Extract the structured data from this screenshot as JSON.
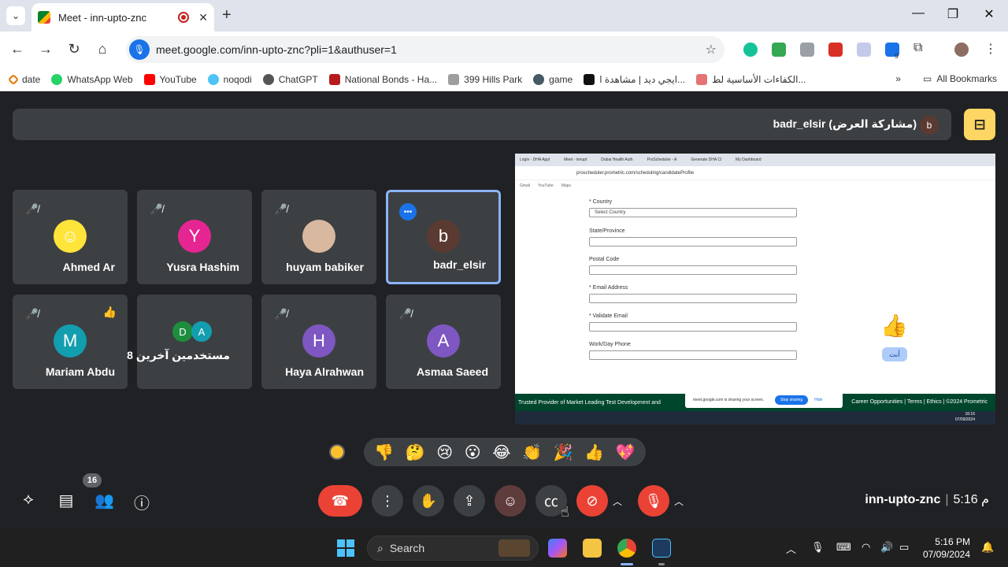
{
  "browser": {
    "tab_title": "Meet - inn-upto-znc",
    "url": "meet.google.com/inn-upto-znc?pli=1&authuser=1",
    "bookmarks": [
      "date",
      "WhatsApp Web",
      "YouTube",
      "noqodi",
      "ChatGPT",
      "National Bonds - Ha...",
      "399 Hills Park",
      "game",
      "ايجي ديد | مشاهدة ا...",
      "الكفاءات الأساسية لط..."
    ],
    "all_bookmarks": "All Bookmarks",
    "ext_badge": "9"
  },
  "presenter": {
    "label": "badr_elsir (مشاركة العرض)",
    "avatar_letter": "b"
  },
  "participants": [
    {
      "name": "Ahmed Ar",
      "letter": "",
      "color": "#ffe43a"
    },
    {
      "name": "Yusra Hashim",
      "letter": "Y",
      "color": "#e52592"
    },
    {
      "name": "huyam babiker",
      "letter": "",
      "color": "#d9b8a0"
    },
    {
      "name": "badr_elsir",
      "letter": "b",
      "color": "#5b3a32"
    },
    {
      "name": "Mariam Abdu",
      "letter": "M",
      "color": "#129eaf",
      "reaction": "👍"
    },
    {
      "name": "8 مستخدمين آخرين",
      "letters": [
        "D",
        "A"
      ],
      "colors": [
        "#1e8e3e",
        "#129eaf"
      ]
    },
    {
      "name": "Haya Alrahwan",
      "letter": "H",
      "color": "#7e57c2"
    },
    {
      "name": "Asmaa Saeed",
      "letter": "A",
      "color": "#7e57c2"
    }
  ],
  "shared_screen": {
    "tabs": [
      "Login - DHA Appl",
      "Meet - innupt",
      "Dubai Health Auth",
      "ProScheduler - A",
      "Generate DHA Cl",
      "My Dashboard"
    ],
    "url": "proscheduler.prometric.com/scheduling/candidateProfile",
    "bookmarks": [
      "Gmail",
      "YouTube",
      "Maps"
    ],
    "labels": {
      "country": "* Country",
      "country_select": "Select Country",
      "state": "State/Province",
      "postal": "Postal Code",
      "email": "* Email Address",
      "validate": "* Validate Email",
      "phone": "Work/Day Phone"
    },
    "footer_left": "Trusted Provider of Market Leading Test Development and",
    "footer_right": "Career Opportunities | Terms | Ethics | ©2024 Prometric",
    "share_notice": "meet.google.com is sharing your screen.",
    "stop_sharing": "Stop sharing",
    "hide": "Hide",
    "you_label": "أنت",
    "task_time": "16:16",
    "task_date": "07/09/2024"
  },
  "reactions": [
    "👎",
    "🤔",
    "😢",
    "😮",
    "😂",
    "👏",
    "🎉",
    "👍",
    "💖"
  ],
  "meeting": {
    "people_count": "16",
    "code": "inn-upto-znc",
    "time": "5:16 م"
  },
  "taskbar": {
    "search_label": "Search",
    "time": "5:16 PM",
    "date": "07/09/2024"
  }
}
